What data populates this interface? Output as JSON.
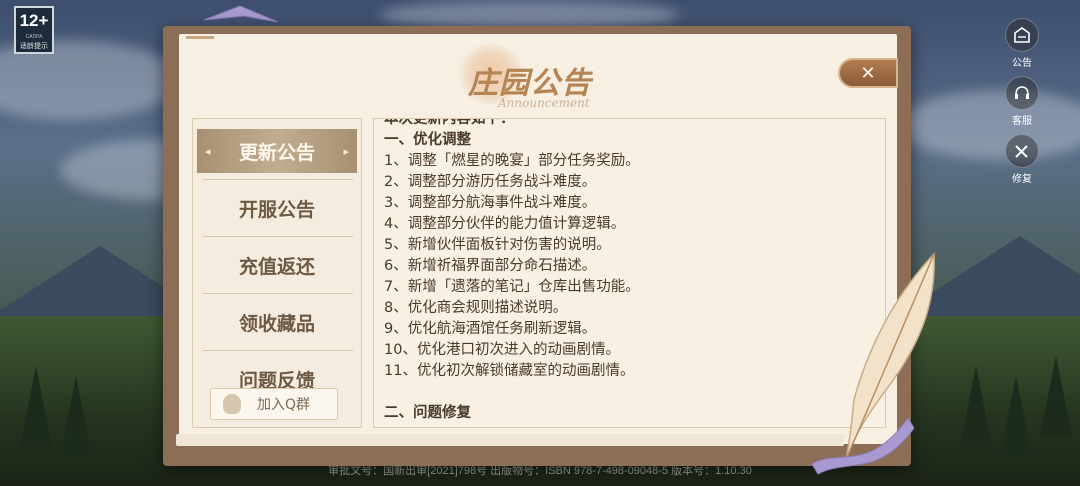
{
  "age_rating": {
    "age": "12+",
    "tip": "适龄提示",
    "org": "CADPA"
  },
  "side_icons": [
    {
      "name": "announcement",
      "label": "公告"
    },
    {
      "name": "support",
      "label": "客服"
    },
    {
      "name": "repair",
      "label": "修复"
    }
  ],
  "dialog": {
    "title": "庄园公告",
    "subtitle": "Announcement",
    "close_symbol": "✕"
  },
  "menu": {
    "items": [
      {
        "label": "更新公告",
        "active": true
      },
      {
        "label": "开服公告",
        "active": false
      },
      {
        "label": "充值返还",
        "active": false
      },
      {
        "label": "领收藏品",
        "active": false
      },
      {
        "label": "问题反馈",
        "active": false
      }
    ],
    "join_label": "加入Q群"
  },
  "content": {
    "intro": "本次更新内容如下：",
    "section1_title": "一、优化调整",
    "lines": [
      "1、调整「燃星的晚宴」部分任务奖励。",
      "2、调整部分游历任务战斗难度。",
      "3、调整部分航海事件战斗难度。",
      "4、调整部分伙伴的能力值计算逻辑。",
      "5、新增伙伴面板针对伤害的说明。",
      "6、新增祈福界面部分命石描述。",
      "7、新增「遗落的笔记」仓库出售功能。",
      "8、优化商会规则描述说明。",
      "9、优化航海酒馆任务刷新逻辑。",
      "10、优化港口初次进入的动画剧情。",
      "11、优化初次解锁储藏室的动画剧情。"
    ],
    "section2_title": "二、问题修复"
  },
  "footer": {
    "text": "审批文号：国新出审[2021]798号  出版物号：ISBN 978-7-498-09048-5  版本号：1.10.30"
  },
  "colors": {
    "accent": "#b58453",
    "menu_active": "#b09a7e",
    "text": "#4a3a2c",
    "paper": "#f6efe2",
    "frame": "#8b6e55"
  }
}
